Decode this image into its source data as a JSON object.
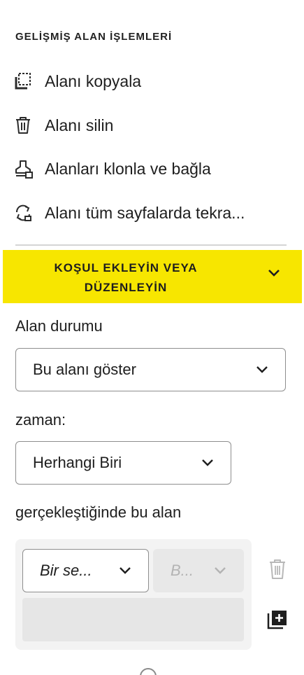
{
  "advanced": {
    "title": "GELİŞMİŞ ALAN İŞLEMLERİ",
    "actions": [
      {
        "label": "Alanı kopyala",
        "icon": "copy-field-icon"
      },
      {
        "label": "Alanı silin",
        "icon": "trash-icon"
      },
      {
        "label": "Alanları klonla ve bağla",
        "icon": "clone-stamp-icon"
      },
      {
        "label": "Alanı tüm sayfalarda tekra...",
        "icon": "repeat-pages-icon"
      }
    ]
  },
  "condition": {
    "header_line1": "KOŞUL EKLEYİN VEYA",
    "header_line2": "DÜZENLEYİN",
    "highlight_color": "#f7e600",
    "field_state_label": "Alan durumu",
    "field_state_value": "Bu alanı göster",
    "when_label": "zaman:",
    "when_value": "Herhangi Biri",
    "occurs_label": "gerçekleştiğinde bu alan",
    "rule_field_value": "Bir se...",
    "rule_operator_value": "B..."
  }
}
